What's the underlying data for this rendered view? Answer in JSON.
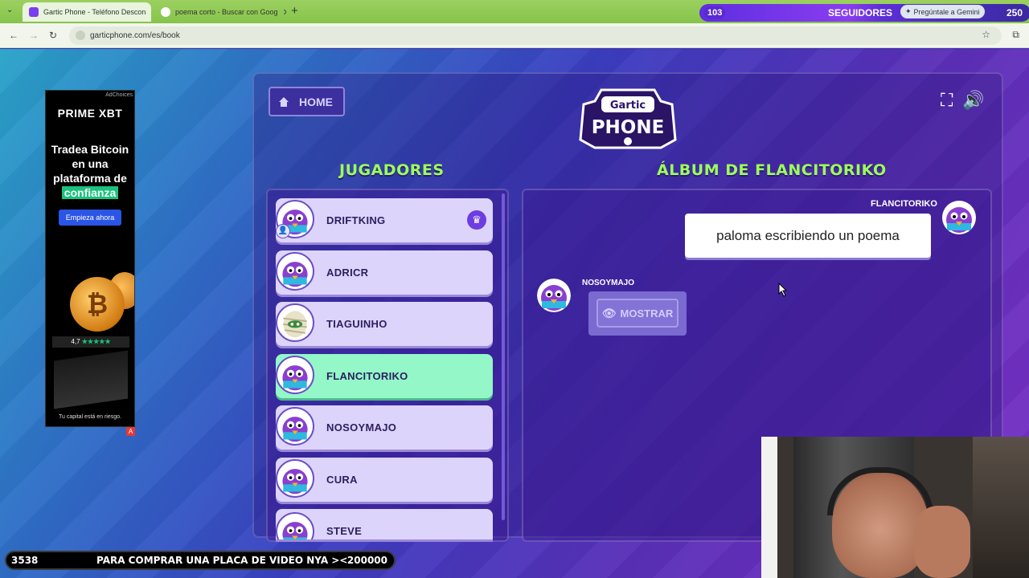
{
  "browser": {
    "tabs": [
      {
        "title": "Gartic Phone - Teléfono Descon",
        "active": true
      },
      {
        "title": "poema corto - Buscar con Goog",
        "active": false
      }
    ],
    "url": "garticphone.com/es/book",
    "gemini_label": "Pregúntale a Gemini"
  },
  "stream": {
    "followers_current": "103",
    "followers_label": "SEGUIDORES",
    "followers_goal": "250",
    "goal_current": "3538",
    "goal_text": "PARA COMPRAR UNA PLACA DE VIDEO NYA ><",
    "goal_target": "200000"
  },
  "ad": {
    "brand": "PRIME XBT",
    "headline": "Tradea Bitcoin en una plataforma de",
    "highlight": "confianza",
    "cta": "Empieza ahora",
    "rating": "4,7",
    "stars": "★★★★★",
    "disclaimer": "Tu capital está en riesgo.",
    "choice": "AdChoices",
    "flag": "A"
  },
  "game": {
    "home_label": "HOME",
    "logo_top": "Gartic",
    "logo_bottom": "PHONE",
    "players_title": "JUGADORES",
    "album_title": "ÁLBUM DE FLANCITORIKO",
    "players": [
      {
        "name": "DRIFTKING",
        "host": true
      },
      {
        "name": "ADRICR"
      },
      {
        "name": "TIAGUINHO"
      },
      {
        "name": "FLANCITORIKO",
        "active": true
      },
      {
        "name": "NOSOYMAJO"
      },
      {
        "name": "CURA"
      },
      {
        "name": "STEVE"
      }
    ],
    "album": {
      "entry1_author": "FLANCITORIKO",
      "entry1_text": "paloma escribiendo un poema",
      "entry2_author": "NOSOYMAJO",
      "show_button": "MOSTRAR"
    }
  },
  "colors": {
    "accent_green": "#9dff5a",
    "active_player": "#93f7c8",
    "player_bg": "#ddd4fb"
  }
}
